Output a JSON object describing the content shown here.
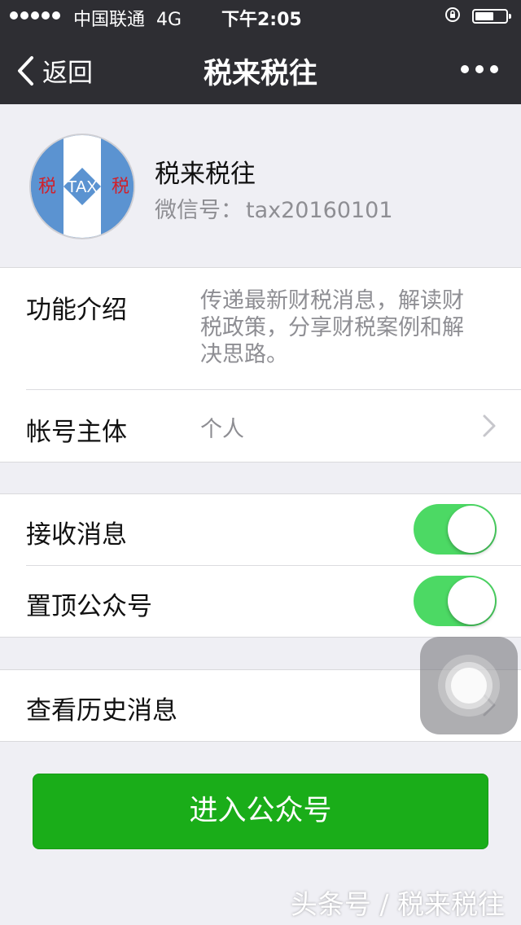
{
  "status_bar": {
    "carrier": "中国联通",
    "network": "4G",
    "time": "下午2:05",
    "signal_dots": 5,
    "battery_level": 0.6
  },
  "nav": {
    "back_label": "返回",
    "title": "税来税往",
    "more_icon": "more-icon"
  },
  "profile": {
    "name": "税来税往",
    "id_label": "微信号：",
    "id_value": "tax20160101",
    "avatar_text": {
      "left": "税",
      "center": "TAX",
      "right": "税"
    }
  },
  "info": {
    "intro_label": "功能介绍",
    "intro_text": "传递最新财税消息，解读财税政策，分享财税案例和解决思路。",
    "owner_label": "帐号主体",
    "owner_value": "个人"
  },
  "settings": {
    "receive_label": "接收消息",
    "receive_on": true,
    "pin_label": "置顶公众号",
    "pin_on": true
  },
  "history": {
    "label": "查看历史消息"
  },
  "enter_button": "进入公众号",
  "watermark": "头条号 / 税来税往",
  "colors": {
    "nav_bg": "#2e2e33",
    "page_bg": "#efeff4",
    "toggle_on": "#4cd964",
    "primary_button": "#1aad19"
  }
}
